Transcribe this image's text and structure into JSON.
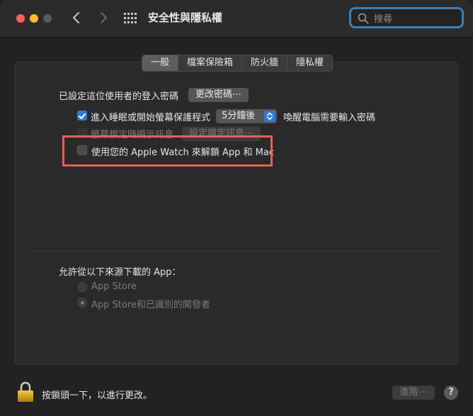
{
  "window": {
    "title": "安全性與隱私權"
  },
  "search": {
    "placeholder": "搜尋"
  },
  "tabs": [
    {
      "label": "一般",
      "active": true
    },
    {
      "label": "檔案保險箱",
      "active": false
    },
    {
      "label": "防火牆",
      "active": false
    },
    {
      "label": "隱私權",
      "active": false
    }
  ],
  "general": {
    "password_label": "已設定這位使用者的登入密碼",
    "change_password_button": "更改密碼⋯",
    "require_password": {
      "checked": true,
      "label_before": "進入睡眠或開始螢幕保護程式",
      "delay_value": "5分鐘後",
      "label_after": "喚醒電腦需要輸入密碼"
    },
    "lock_message": {
      "checked": false,
      "label": "螢幕鎖定時顯示訊息",
      "button": "設定鎖定訊息⋯"
    },
    "apple_watch": {
      "checked": false,
      "label": "使用您的 Apple Watch 來解鎖 App 和 Mac"
    }
  },
  "downloads": {
    "heading": "允許從以下來源下載的 App：",
    "options": [
      {
        "label": "App Store",
        "selected": false
      },
      {
        "label": "App Store和已識別的開發者",
        "selected": true
      }
    ]
  },
  "footer": {
    "lock_text": "按鎖頭一下，以進行更改。",
    "advanced_button": "進階⋯",
    "help_label": "?"
  },
  "colors": {
    "accent": "#3478d4",
    "highlight_box": "#e95d5a",
    "search_focus_ring": "#3c80b8"
  }
}
